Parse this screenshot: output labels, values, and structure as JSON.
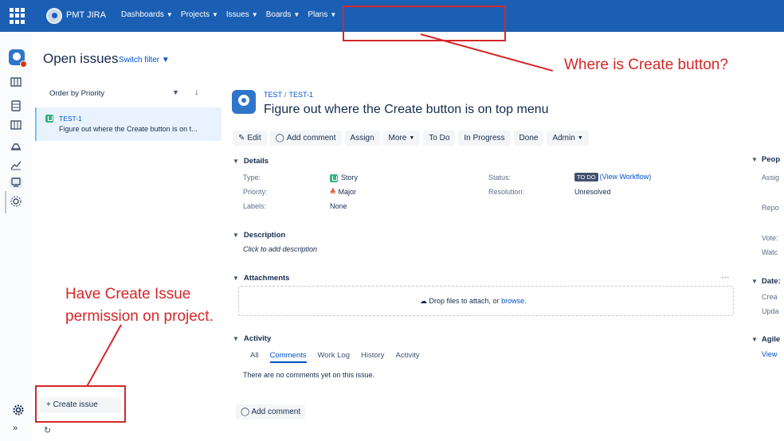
{
  "topbar": {
    "brand": "PMT JIRA",
    "nav": [
      {
        "label": "Dashboards"
      },
      {
        "label": "Projects"
      },
      {
        "label": "Issues"
      },
      {
        "label": "Boards"
      },
      {
        "label": "Plans"
      }
    ],
    "background": "#1a5fb4"
  },
  "page": {
    "title": "Open issues",
    "switch_filter": "Switch filter"
  },
  "issue_list": {
    "order_by": "Order by Priority",
    "items": [
      {
        "key": "TEST-1",
        "summary": "Figure out where the Create button is on t..."
      }
    ]
  },
  "issue": {
    "breadcrumb_project": "TEST",
    "breadcrumb_sep": "/",
    "breadcrumb_key": "TEST-1",
    "title": "Figure out where the Create button is on top menu",
    "toolbar": {
      "edit": "Edit",
      "add_comment": "Add comment",
      "assign": "Assign",
      "more": "More",
      "to_do": "To Do",
      "in_progress": "In Progress",
      "done": "Done",
      "admin": "Admin"
    },
    "details": {
      "heading": "Details",
      "type_label": "Type:",
      "type_value": "Story",
      "priority_label": "Priority:",
      "priority_value": "Major",
      "labels_label": "Labels:",
      "labels_value": "None",
      "status_label": "Status:",
      "status_badge": "TO DO",
      "view_workflow": "(View Workflow)",
      "resolution_label": "Resolution:",
      "resolution_value": "Unresolved"
    },
    "description": {
      "heading": "Description",
      "placeholder": "Click to add description"
    },
    "attachments": {
      "heading": "Attachments",
      "more": "...",
      "drop_text": "Drop files to attach, or ",
      "browse": "browse."
    },
    "activity": {
      "heading": "Activity",
      "tabs": [
        "All",
        "Comments",
        "Work Log",
        "History",
        "Activity"
      ],
      "active_tab": "Comments",
      "empty": "There are no comments yet on this issue."
    },
    "add_comment": "Add comment"
  },
  "right_panel": {
    "people": "Peop",
    "assignee": "Assig",
    "reporter": "Repo",
    "votes": "Vote:",
    "watchers": "Watc",
    "dates": "Date:",
    "created": "Crea",
    "updated": "Upda",
    "agile": "Agile",
    "view": "View"
  },
  "bottom": {
    "create_issue": "+ Create issue"
  },
  "annotations": {
    "where_create": "Where is Create button?",
    "have_permission_line1": "Have Create Issue",
    "have_permission_line2": "permission on project.",
    "color": "#d62728"
  }
}
